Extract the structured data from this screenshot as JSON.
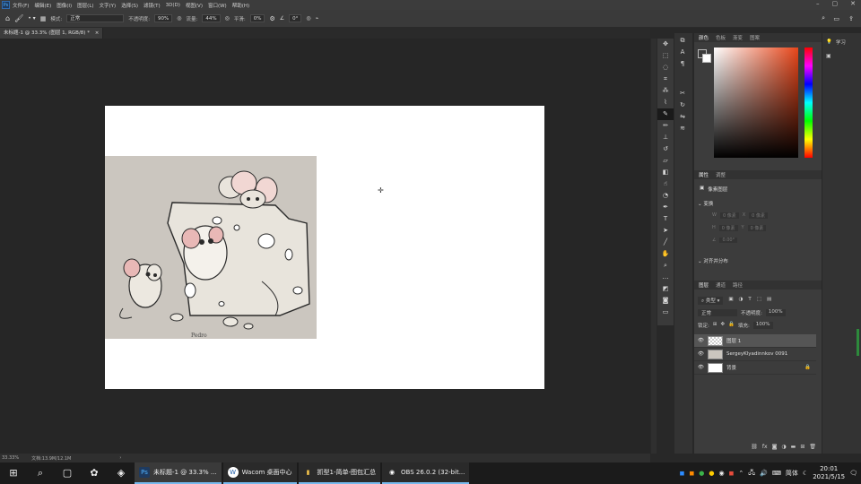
{
  "menubar": {
    "logo": "Ps",
    "items": [
      "文件(F)",
      "编辑(E)",
      "图像(I)",
      "图层(L)",
      "文字(Y)",
      "选择(S)",
      "滤镜(T)",
      "3D(D)",
      "视图(V)",
      "窗口(W)",
      "帮助(H)"
    ],
    "window_controls": [
      "–",
      "▢",
      "✕"
    ]
  },
  "options": {
    "mode_label": "模式:",
    "mode_value": "正常",
    "opacity_label": "不透明度:",
    "opacity_value": "90%",
    "flow_label": "流量:",
    "flow_value": "44%",
    "smooth_label": "平滑:",
    "smooth_value": "0%",
    "angle_value": "0°"
  },
  "document": {
    "tab_title": "未标题-1 @ 33.3% (图层 1, RGB/8) *",
    "artwork_signature": "Pedro"
  },
  "status": {
    "zoom": "33.33%",
    "doc_info": "文档:13.9M/12.1M"
  },
  "color_panel": {
    "tabs": [
      "颜色",
      "色板",
      "渐变",
      "图案"
    ]
  },
  "properties_panel": {
    "tabs": [
      "属性",
      "调整"
    ],
    "type_label": "像素图层",
    "section_transform": "变换",
    "w_label": "W",
    "w_value": "0 像素",
    "h_label": "H",
    "h_value": "0 像素",
    "x_label": "X",
    "x_value": "0 像素",
    "y_label": "Y",
    "y_value": "0 像素",
    "angle_value": "0.00°",
    "section_align": "对齐并分布"
  },
  "layers_panel": {
    "tabs": [
      "图层",
      "通道",
      "路径"
    ],
    "kind_filter": "类型",
    "blend_mode": "正常",
    "opacity_label": "不透明度:",
    "opacity_value": "100%",
    "lock_label": "锁定:",
    "fill_label": "填充:",
    "fill_value": "100%",
    "layers": [
      {
        "name": "图层 1",
        "selected": true
      },
      {
        "name": "SergeyKlyadinnkov 0091",
        "selected": false
      },
      {
        "name": "背景",
        "selected": false
      }
    ]
  },
  "far_panel": {
    "learn_label": "学习"
  },
  "taskbar": {
    "apps": [
      {
        "label": "未标题-1 @ 33.3% ...",
        "icon": "Ps",
        "color": "#1e3a5f"
      },
      {
        "label": "Wacom 桌面中心",
        "icon": "W",
        "color": "#ffffff"
      },
      {
        "label": "抓型1-简单-图包汇总",
        "icon": "▮",
        "color": "#f0c14b"
      },
      {
        "label": "OBS 26.0.2 (32-bit...",
        "icon": "◉",
        "color": "#2b2b2b"
      }
    ],
    "ime": "简体",
    "time": "20:01",
    "date": "2021/5/15"
  }
}
